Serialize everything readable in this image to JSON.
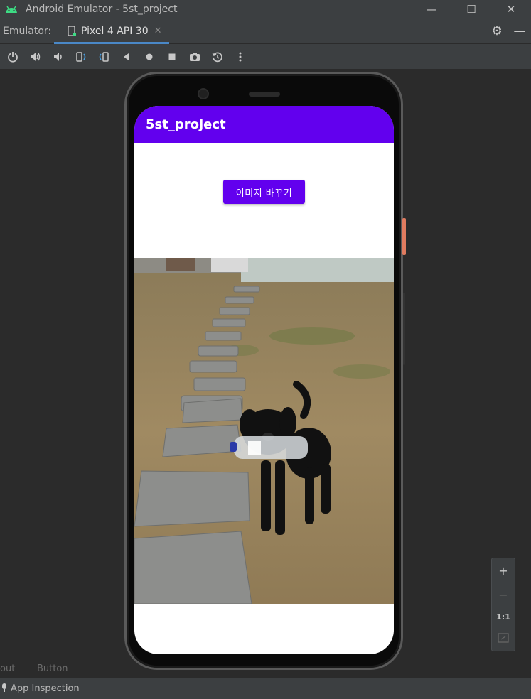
{
  "window": {
    "title": "Android Emulator - 5st_project",
    "minimize": "—",
    "maximize": "☐",
    "close": "✕"
  },
  "tabbar": {
    "label": "Emulator:",
    "tab_label": "Pixel 4 API 30",
    "tab_close": "✕",
    "settings": "⚙",
    "hide": "—"
  },
  "toolbar": {
    "buttons": [
      "power-icon",
      "volume-up-icon",
      "volume-down-icon",
      "rotate-left-icon",
      "rotate-right-icon",
      "back-icon",
      "home-icon",
      "overview-icon",
      "screenshot-icon",
      "snapshot-icon",
      "more-icon"
    ]
  },
  "app": {
    "title": "5st_project",
    "button_label": "이미지 바꾸기",
    "accent": "#6200ee"
  },
  "zoom": {
    "zoom_in": "+",
    "zoom_out": "−",
    "one_to_one": "1:1"
  },
  "bottom_strip": {
    "left": "out",
    "right": "Button"
  },
  "statusbar": {
    "item": "App Inspection"
  }
}
